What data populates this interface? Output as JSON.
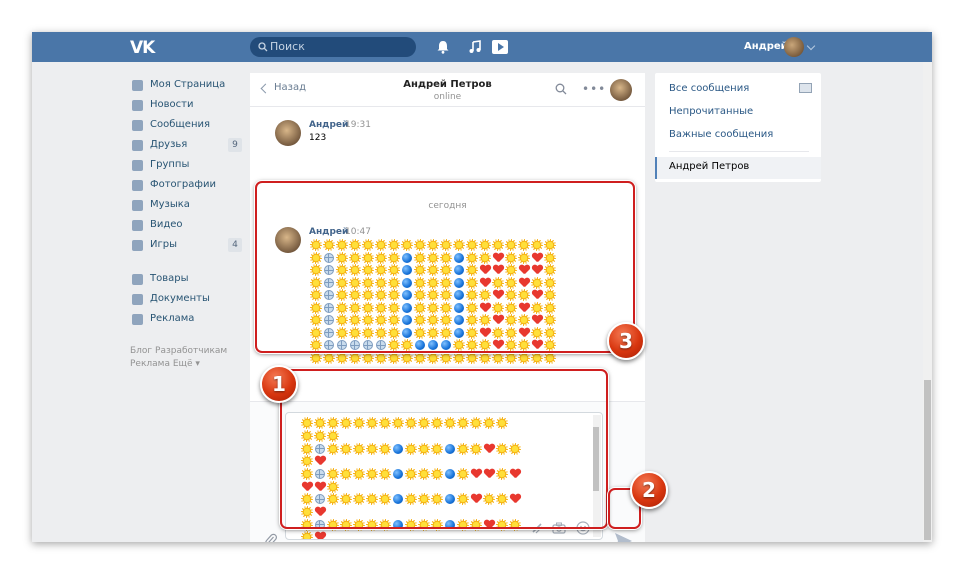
{
  "topbar": {
    "logo": "VK",
    "search_placeholder": "Поиск",
    "user_name": "Андрей",
    "icons": [
      "bell-icon",
      "music-note-icon",
      "video-play-icon"
    ],
    "colors": {
      "bar": "#4a76a8",
      "search": "#224b7a"
    }
  },
  "left_menu": {
    "items": [
      {
        "label": "Моя Страница",
        "icon": "home-icon"
      },
      {
        "label": "Новости",
        "icon": "news-icon"
      },
      {
        "label": "Сообщения",
        "icon": "messages-icon"
      },
      {
        "label": "Друзья",
        "icon": "friends-icon",
        "badge": "9"
      },
      {
        "label": "Группы",
        "icon": "groups-icon"
      },
      {
        "label": "Фотографии",
        "icon": "photos-icon"
      },
      {
        "label": "Музыка",
        "icon": "music-icon"
      },
      {
        "label": "Видео",
        "icon": "video-icon"
      },
      {
        "label": "Игры",
        "icon": "games-icon",
        "badge": "4"
      },
      {
        "label": "Товары",
        "icon": "goods-icon"
      },
      {
        "label": "Документы",
        "icon": "documents-icon"
      },
      {
        "label": "Реклама",
        "icon": "ads-icon"
      }
    ],
    "footer_line1": "Блог  Разработчикам",
    "footer_line2": "Реклама  Ещё ▾"
  },
  "chat": {
    "back_label": "Назад",
    "peer_name": "Андрей Петров",
    "peer_status": "online",
    "day_divider": "сегодня",
    "messages": [
      {
        "author": "Андрей",
        "time": "19:31",
        "text": "123"
      },
      {
        "author": "Андрей",
        "time": "10:47",
        "text": ""
      }
    ],
    "emoji_art": [
      "SSSSSSSSSSSSSSSSSSS",
      "SGSSSSSBSSSBSSHSSHS",
      "SGSSSSSBSSSBSHHSHHS",
      "SGSSSSSBSSSBSHSSHSS",
      "SGSSSSSBSSSBSSHSSHS",
      "SGSSSSSBSSSBSHSSHSS",
      "SGSSSSSBSSSBSSHSSHS",
      "SGSSSSSBSSSBSHSSHSS",
      "SGGGGGSSBBBSSSHSSHS",
      "SSSSSSSSSSSSSSSSSSS"
    ],
    "composer_art": [
      "SSSSSSSSSSSSSSSS",
      "SSS",
      "SGSSSSSBSSSBSSHSS",
      "SH",
      "SGSSSSSBSSSBSHHSH",
      "HHS",
      "SGSSSSSBSSSBSHSSH",
      "SH",
      "SGSSSSSBSSSBSSHSS",
      "SH",
      "SGSSSSSBSSSBSHSS",
      "SH"
    ]
  },
  "right_panel": {
    "items": [
      "Все сообщения",
      "Непрочитанные",
      "Важные сообщения"
    ],
    "active": "Андрей Петров"
  },
  "annotations": [
    "1",
    "2",
    "3"
  ],
  "colors": {
    "frame": "#cf1f1f",
    "badge": "#d8360f",
    "link": "#2a5885"
  }
}
